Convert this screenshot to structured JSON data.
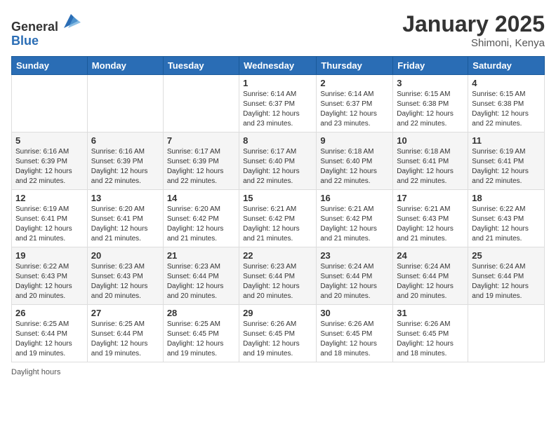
{
  "header": {
    "logo_line1": "General",
    "logo_line2": "Blue",
    "month_year": "January 2025",
    "location": "Shimoni, Kenya"
  },
  "weekdays": [
    "Sunday",
    "Monday",
    "Tuesday",
    "Wednesday",
    "Thursday",
    "Friday",
    "Saturday"
  ],
  "weeks": [
    [
      {
        "day": "",
        "info": ""
      },
      {
        "day": "",
        "info": ""
      },
      {
        "day": "",
        "info": ""
      },
      {
        "day": "1",
        "info": "Sunrise: 6:14 AM\nSunset: 6:37 PM\nDaylight: 12 hours and 23 minutes."
      },
      {
        "day": "2",
        "info": "Sunrise: 6:14 AM\nSunset: 6:37 PM\nDaylight: 12 hours and 23 minutes."
      },
      {
        "day": "3",
        "info": "Sunrise: 6:15 AM\nSunset: 6:38 PM\nDaylight: 12 hours and 22 minutes."
      },
      {
        "day": "4",
        "info": "Sunrise: 6:15 AM\nSunset: 6:38 PM\nDaylight: 12 hours and 22 minutes."
      }
    ],
    [
      {
        "day": "5",
        "info": "Sunrise: 6:16 AM\nSunset: 6:39 PM\nDaylight: 12 hours and 22 minutes."
      },
      {
        "day": "6",
        "info": "Sunrise: 6:16 AM\nSunset: 6:39 PM\nDaylight: 12 hours and 22 minutes."
      },
      {
        "day": "7",
        "info": "Sunrise: 6:17 AM\nSunset: 6:39 PM\nDaylight: 12 hours and 22 minutes."
      },
      {
        "day": "8",
        "info": "Sunrise: 6:17 AM\nSunset: 6:40 PM\nDaylight: 12 hours and 22 minutes."
      },
      {
        "day": "9",
        "info": "Sunrise: 6:18 AM\nSunset: 6:40 PM\nDaylight: 12 hours and 22 minutes."
      },
      {
        "day": "10",
        "info": "Sunrise: 6:18 AM\nSunset: 6:41 PM\nDaylight: 12 hours and 22 minutes."
      },
      {
        "day": "11",
        "info": "Sunrise: 6:19 AM\nSunset: 6:41 PM\nDaylight: 12 hours and 22 minutes."
      }
    ],
    [
      {
        "day": "12",
        "info": "Sunrise: 6:19 AM\nSunset: 6:41 PM\nDaylight: 12 hours and 21 minutes."
      },
      {
        "day": "13",
        "info": "Sunrise: 6:20 AM\nSunset: 6:41 PM\nDaylight: 12 hours and 21 minutes."
      },
      {
        "day": "14",
        "info": "Sunrise: 6:20 AM\nSunset: 6:42 PM\nDaylight: 12 hours and 21 minutes."
      },
      {
        "day": "15",
        "info": "Sunrise: 6:21 AM\nSunset: 6:42 PM\nDaylight: 12 hours and 21 minutes."
      },
      {
        "day": "16",
        "info": "Sunrise: 6:21 AM\nSunset: 6:42 PM\nDaylight: 12 hours and 21 minutes."
      },
      {
        "day": "17",
        "info": "Sunrise: 6:21 AM\nSunset: 6:43 PM\nDaylight: 12 hours and 21 minutes."
      },
      {
        "day": "18",
        "info": "Sunrise: 6:22 AM\nSunset: 6:43 PM\nDaylight: 12 hours and 21 minutes."
      }
    ],
    [
      {
        "day": "19",
        "info": "Sunrise: 6:22 AM\nSunset: 6:43 PM\nDaylight: 12 hours and 20 minutes."
      },
      {
        "day": "20",
        "info": "Sunrise: 6:23 AM\nSunset: 6:43 PM\nDaylight: 12 hours and 20 minutes."
      },
      {
        "day": "21",
        "info": "Sunrise: 6:23 AM\nSunset: 6:44 PM\nDaylight: 12 hours and 20 minutes."
      },
      {
        "day": "22",
        "info": "Sunrise: 6:23 AM\nSunset: 6:44 PM\nDaylight: 12 hours and 20 minutes."
      },
      {
        "day": "23",
        "info": "Sunrise: 6:24 AM\nSunset: 6:44 PM\nDaylight: 12 hours and 20 minutes."
      },
      {
        "day": "24",
        "info": "Sunrise: 6:24 AM\nSunset: 6:44 PM\nDaylight: 12 hours and 20 minutes."
      },
      {
        "day": "25",
        "info": "Sunrise: 6:24 AM\nSunset: 6:44 PM\nDaylight: 12 hours and 19 minutes."
      }
    ],
    [
      {
        "day": "26",
        "info": "Sunrise: 6:25 AM\nSunset: 6:44 PM\nDaylight: 12 hours and 19 minutes."
      },
      {
        "day": "27",
        "info": "Sunrise: 6:25 AM\nSunset: 6:44 PM\nDaylight: 12 hours and 19 minutes."
      },
      {
        "day": "28",
        "info": "Sunrise: 6:25 AM\nSunset: 6:45 PM\nDaylight: 12 hours and 19 minutes."
      },
      {
        "day": "29",
        "info": "Sunrise: 6:26 AM\nSunset: 6:45 PM\nDaylight: 12 hours and 19 minutes."
      },
      {
        "day": "30",
        "info": "Sunrise: 6:26 AM\nSunset: 6:45 PM\nDaylight: 12 hours and 18 minutes."
      },
      {
        "day": "31",
        "info": "Sunrise: 6:26 AM\nSunset: 6:45 PM\nDaylight: 12 hours and 18 minutes."
      },
      {
        "day": "",
        "info": ""
      }
    ]
  ],
  "footer": {
    "note": "Daylight hours"
  }
}
